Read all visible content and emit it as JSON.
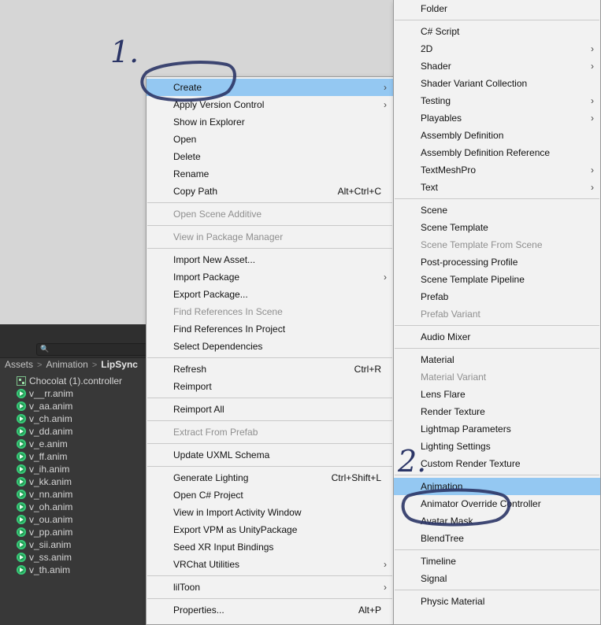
{
  "project": {
    "breadcrumb": [
      "Assets",
      "Animation",
      "LipSync"
    ],
    "assets": [
      {
        "name": "Chocolat (1).controller",
        "icon": "animator-controller-icon"
      },
      {
        "name": "v__rr.anim",
        "icon": "animation-clip-icon"
      },
      {
        "name": "v_aa.anim",
        "icon": "animation-clip-icon"
      },
      {
        "name": "v_ch.anim",
        "icon": "animation-clip-icon"
      },
      {
        "name": "v_dd.anim",
        "icon": "animation-clip-icon"
      },
      {
        "name": "v_e.anim",
        "icon": "animation-clip-icon"
      },
      {
        "name": "v_ff.anim",
        "icon": "animation-clip-icon"
      },
      {
        "name": "v_ih.anim",
        "icon": "animation-clip-icon"
      },
      {
        "name": "v_kk.anim",
        "icon": "animation-clip-icon"
      },
      {
        "name": "v_nn.anim",
        "icon": "animation-clip-icon"
      },
      {
        "name": "v_oh.anim",
        "icon": "animation-clip-icon"
      },
      {
        "name": "v_ou.anim",
        "icon": "animation-clip-icon"
      },
      {
        "name": "v_pp.anim",
        "icon": "animation-clip-icon"
      },
      {
        "name": "v_sii.anim",
        "icon": "animation-clip-icon"
      },
      {
        "name": "v_ss.anim",
        "icon": "animation-clip-icon"
      },
      {
        "name": "v_th.anim",
        "icon": "animation-clip-icon"
      }
    ]
  },
  "main_menu": {
    "items": [
      {
        "label": "Create",
        "submenu": true,
        "highlight": true
      },
      {
        "label": "Apply Version Control",
        "submenu": true
      },
      {
        "label": "Show in Explorer"
      },
      {
        "label": "Open"
      },
      {
        "label": "Delete"
      },
      {
        "label": "Rename"
      },
      {
        "label": "Copy Path",
        "shortcut": "Alt+Ctrl+C"
      },
      {
        "separator": true
      },
      {
        "label": "Open Scene Additive",
        "disabled": true
      },
      {
        "separator": true
      },
      {
        "label": "View in Package Manager",
        "disabled": true
      },
      {
        "separator": true
      },
      {
        "label": "Import New Asset..."
      },
      {
        "label": "Import Package",
        "submenu": true
      },
      {
        "label": "Export Package..."
      },
      {
        "label": "Find References In Scene",
        "disabled": true
      },
      {
        "label": "Find References In Project"
      },
      {
        "label": "Select Dependencies"
      },
      {
        "separator": true
      },
      {
        "label": "Refresh",
        "shortcut": "Ctrl+R"
      },
      {
        "label": "Reimport"
      },
      {
        "separator": true
      },
      {
        "label": "Reimport All"
      },
      {
        "separator": true
      },
      {
        "label": "Extract From Prefab",
        "disabled": true
      },
      {
        "separator": true
      },
      {
        "label": "Update UXML Schema"
      },
      {
        "separator": true
      },
      {
        "label": "Generate Lighting",
        "shortcut": "Ctrl+Shift+L"
      },
      {
        "label": "Open C# Project"
      },
      {
        "label": "View in Import Activity Window"
      },
      {
        "label": "Export VPM as UnityPackage"
      },
      {
        "label": "Seed XR Input Bindings"
      },
      {
        "label": "VRChat Utilities",
        "submenu": true
      },
      {
        "separator": true
      },
      {
        "label": "lilToon",
        "submenu": true
      },
      {
        "separator": true
      },
      {
        "label": "Properties...",
        "shortcut": "Alt+P"
      }
    ]
  },
  "create_submenu": {
    "items": [
      {
        "label": "Folder"
      },
      {
        "separator": true
      },
      {
        "label": "C# Script"
      },
      {
        "label": "2D",
        "submenu": true
      },
      {
        "label": "Shader",
        "submenu": true
      },
      {
        "label": "Shader Variant Collection"
      },
      {
        "label": "Testing",
        "submenu": true
      },
      {
        "label": "Playables",
        "submenu": true
      },
      {
        "label": "Assembly Definition"
      },
      {
        "label": "Assembly Definition Reference"
      },
      {
        "label": "TextMeshPro",
        "submenu": true
      },
      {
        "label": "Text",
        "submenu": true
      },
      {
        "separator": true
      },
      {
        "label": "Scene"
      },
      {
        "label": "Scene Template"
      },
      {
        "label": "Scene Template From Scene",
        "disabled": true
      },
      {
        "label": "Post-processing Profile"
      },
      {
        "label": "Scene Template Pipeline"
      },
      {
        "label": "Prefab"
      },
      {
        "label": "Prefab Variant",
        "disabled": true
      },
      {
        "separator": true
      },
      {
        "label": "Audio Mixer"
      },
      {
        "separator": true
      },
      {
        "label": "Material"
      },
      {
        "label": "Material Variant",
        "disabled": true
      },
      {
        "label": "Lens Flare"
      },
      {
        "label": "Render Texture"
      },
      {
        "label": "Lightmap Parameters"
      },
      {
        "label": "Lighting Settings"
      },
      {
        "label": "Custom Render Texture"
      },
      {
        "separator": true
      },
      {
        "label": "Animation",
        "highlight": true
      },
      {
        "label": "Animator Override Controller"
      },
      {
        "label": "Avatar Mask"
      },
      {
        "label": "BlendTree"
      },
      {
        "separator": true
      },
      {
        "label": "Timeline"
      },
      {
        "label": "Signal"
      },
      {
        "separator": true
      },
      {
        "label": "Physic Material"
      }
    ]
  },
  "annotations": {
    "step1": "1.",
    "step2": "2.",
    "ink_color": "#2b3566"
  },
  "colors": {
    "highlight": "#94c8f2",
    "menu_bg": "#f2f2f2",
    "disabled_text": "#8f8f8f"
  }
}
